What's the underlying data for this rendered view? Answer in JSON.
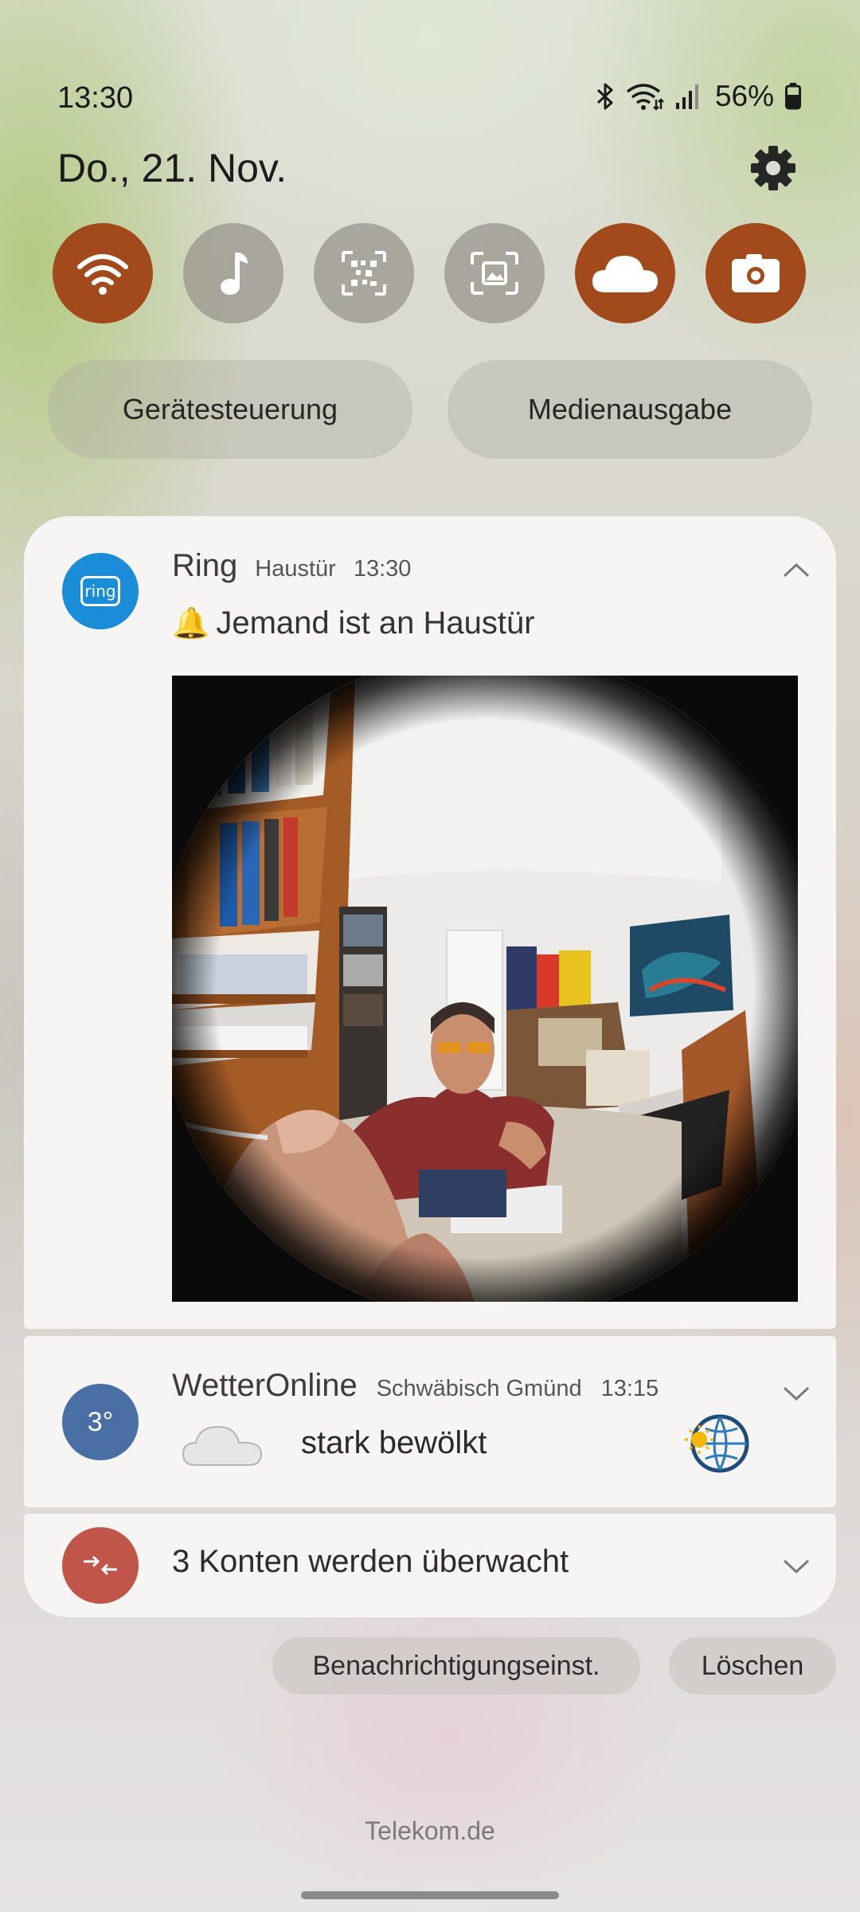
{
  "status_bar": {
    "time": "13:30",
    "battery_percent": "56%",
    "icons": [
      "bluetooth-icon",
      "wifi-data-icon",
      "signal-icon",
      "battery-icon"
    ]
  },
  "header": {
    "date": "Do., 21. Nov."
  },
  "quick_tiles": [
    {
      "name": "wifi",
      "icon": "wifi-icon",
      "active": true
    },
    {
      "name": "music",
      "icon": "music-note-icon",
      "active": false
    },
    {
      "name": "qr-scanner",
      "icon": "qr-scan-icon",
      "active": false
    },
    {
      "name": "screenshot",
      "icon": "screenshot-icon",
      "active": false
    },
    {
      "name": "cloud",
      "icon": "cloud-icon",
      "active": true
    },
    {
      "name": "camera",
      "icon": "camera-icon",
      "active": true
    }
  ],
  "pills": {
    "device_control": "Gerätesteuerung",
    "media_output": "Medienausgabe"
  },
  "notifications": {
    "ring": {
      "icon_text": "ring",
      "app": "Ring",
      "device": "Haustür",
      "time": "13:30",
      "message": "Jemand ist an Haustür",
      "emoji": "🔔"
    },
    "wetter": {
      "icon_text": "3°",
      "app": "WetterOnline",
      "location": "Schwäbisch Gmünd",
      "time": "13:15",
      "message": "stark bewölkt"
    },
    "konten": {
      "message": "3 Konten werden überwacht"
    }
  },
  "actions": {
    "settings": "Benachrichtigungseinst.",
    "clear": "Löschen"
  },
  "carrier": "Telekom.de",
  "colors": {
    "tile_active": "#a24a1b",
    "ring_blue": "#1a8cd8",
    "wetter_blue": "#4a6fa5",
    "konten_red": "#c0564a"
  }
}
